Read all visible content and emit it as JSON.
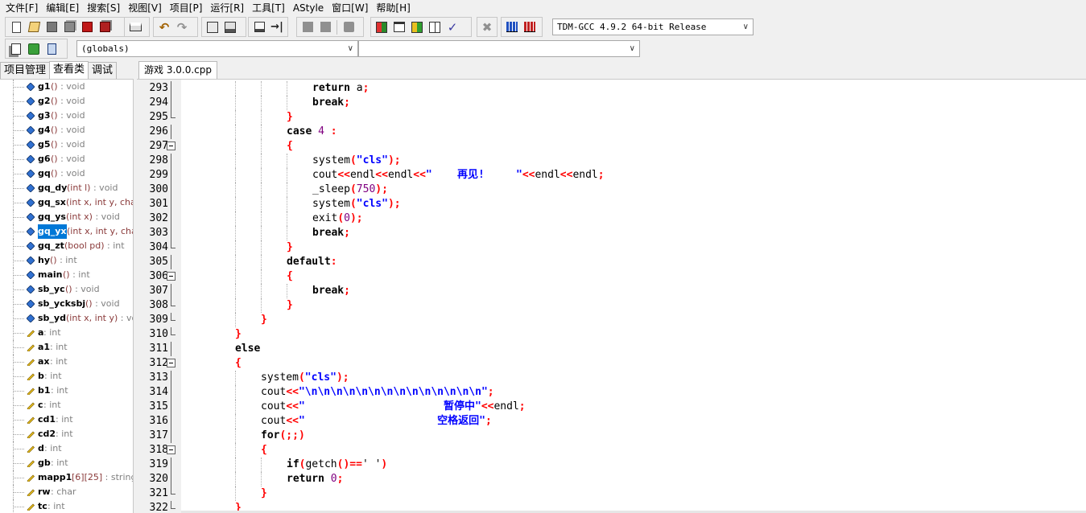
{
  "menu": [
    "文件[F]",
    "编辑[E]",
    "搜索[S]",
    "视图[V]",
    "项目[P]",
    "运行[R]",
    "工具[T]",
    "AStyle",
    "窗口[W]",
    "帮助[H]"
  ],
  "compiler": "TDM-GCC 4.9.2 64-bit Release",
  "scope_combo": "(globals)",
  "member_combo": "",
  "left_tabs": [
    "项目管理",
    "查看类",
    "调试"
  ],
  "active_left_tab": 1,
  "file_tab": "游戏 3.0.0.cpp",
  "colors": {
    "keyword": "#000000",
    "symbol": "#ff0000",
    "string": "#0000ff",
    "number": "#800080",
    "selection": "#0078d7"
  },
  "class_tree": [
    {
      "kind": "function",
      "name": "g1",
      "sig": "()",
      "type": ": void"
    },
    {
      "kind": "function",
      "name": "g2",
      "sig": "()",
      "type": ": void"
    },
    {
      "kind": "function",
      "name": "g3",
      "sig": "()",
      "type": ": void"
    },
    {
      "kind": "function",
      "name": "g4",
      "sig": "()",
      "type": ": void"
    },
    {
      "kind": "function",
      "name": "g5",
      "sig": "()",
      "type": ": void"
    },
    {
      "kind": "function",
      "name": "g6",
      "sig": "()",
      "type": ": void"
    },
    {
      "kind": "function",
      "name": "gq",
      "sig": "()",
      "type": ": void"
    },
    {
      "kind": "function",
      "name": "gq_dy",
      "sig": "(int l)",
      "type": ": void"
    },
    {
      "kind": "function",
      "name": "gq_sx",
      "sig": "(int x, int y, char",
      "type": ""
    },
    {
      "kind": "function",
      "name": "gq_ys",
      "sig": "(int x)",
      "type": ": void"
    },
    {
      "kind": "function",
      "name": "gq_yx",
      "sig": "(int x, int y, char",
      "type": "",
      "selected": true
    },
    {
      "kind": "function",
      "name": "gq_zt",
      "sig": "(bool pd)",
      "type": ": int"
    },
    {
      "kind": "function",
      "name": "hy",
      "sig": "()",
      "type": ": int"
    },
    {
      "kind": "function",
      "name": "main",
      "sig": "()",
      "type": ": int"
    },
    {
      "kind": "function",
      "name": "sb_yc",
      "sig": "()",
      "type": ": void"
    },
    {
      "kind": "function",
      "name": "sb_ycksbj",
      "sig": "()",
      "type": ": void"
    },
    {
      "kind": "function",
      "name": "sb_yd",
      "sig": "(int x, int y)",
      "type": ": voic"
    },
    {
      "kind": "variable",
      "name": "a",
      "sig": "",
      "type": ": int"
    },
    {
      "kind": "variable",
      "name": "a1",
      "sig": "",
      "type": ": int"
    },
    {
      "kind": "variable",
      "name": "ax",
      "sig": "",
      "type": ": int"
    },
    {
      "kind": "variable",
      "name": "b",
      "sig": "",
      "type": ": int"
    },
    {
      "kind": "variable",
      "name": "b1",
      "sig": "",
      "type": ": int"
    },
    {
      "kind": "variable",
      "name": "c",
      "sig": "",
      "type": ": int"
    },
    {
      "kind": "variable",
      "name": "cd1",
      "sig": "",
      "type": ": int"
    },
    {
      "kind": "variable",
      "name": "cd2",
      "sig": "",
      "type": ": int"
    },
    {
      "kind": "variable",
      "name": "d",
      "sig": "",
      "type": ": int"
    },
    {
      "kind": "variable",
      "name": "gb",
      "sig": "",
      "type": ": int"
    },
    {
      "kind": "variable",
      "name": "mapp1",
      "sig": "[6][25]",
      "type": ": string"
    },
    {
      "kind": "variable",
      "name": "rw",
      "sig": "",
      "type": ": char"
    },
    {
      "kind": "variable",
      "name": "tc",
      "sig": "",
      "type": ": int"
    }
  ],
  "code_lines": [
    {
      "n": "293",
      "indent": 4,
      "fold": "",
      "tokens": [
        [
          "kw",
          "return"
        ],
        [
          "id",
          " a"
        ],
        [
          "sym",
          ";"
        ]
      ]
    },
    {
      "n": "294",
      "indent": 4,
      "fold": "",
      "tokens": [
        [
          "kw",
          "break"
        ],
        [
          "sym",
          ";"
        ]
      ]
    },
    {
      "n": "295",
      "indent": 3,
      "fold": "end",
      "tokens": [
        [
          "sym",
          "}"
        ]
      ]
    },
    {
      "n": "296",
      "indent": 3,
      "fold": "",
      "tokens": [
        [
          "kw",
          "case"
        ],
        [
          "id",
          " "
        ],
        [
          "num",
          "4"
        ],
        [
          "id",
          " "
        ],
        [
          "sym",
          ":"
        ]
      ]
    },
    {
      "n": "297",
      "indent": 3,
      "fold": "start",
      "tokens": [
        [
          "sym",
          "{"
        ]
      ]
    },
    {
      "n": "298",
      "indent": 4,
      "fold": "",
      "tokens": [
        [
          "id",
          "system"
        ],
        [
          "sym",
          "("
        ],
        [
          "str",
          "\"cls\""
        ],
        [
          "sym",
          ");"
        ]
      ]
    },
    {
      "n": "299",
      "indent": 4,
      "fold": "",
      "tokens": [
        [
          "id",
          "cout"
        ],
        [
          "sym",
          "<<"
        ],
        [
          "id",
          "endl"
        ],
        [
          "sym",
          "<<"
        ],
        [
          "id",
          "endl"
        ],
        [
          "sym",
          "<<"
        ],
        [
          "str",
          "\"    再见!     \""
        ],
        [
          "sym",
          "<<"
        ],
        [
          "id",
          "endl"
        ],
        [
          "sym",
          "<<"
        ],
        [
          "id",
          "endl"
        ],
        [
          "sym",
          ";"
        ]
      ]
    },
    {
      "n": "300",
      "indent": 4,
      "fold": "",
      "tokens": [
        [
          "id",
          "_sleep"
        ],
        [
          "sym",
          "("
        ],
        [
          "num",
          "750"
        ],
        [
          "sym",
          ");"
        ]
      ]
    },
    {
      "n": "301",
      "indent": 4,
      "fold": "",
      "tokens": [
        [
          "id",
          "system"
        ],
        [
          "sym",
          "("
        ],
        [
          "str",
          "\"cls\""
        ],
        [
          "sym",
          ");"
        ]
      ]
    },
    {
      "n": "302",
      "indent": 4,
      "fold": "",
      "tokens": [
        [
          "id",
          "exit"
        ],
        [
          "sym",
          "("
        ],
        [
          "num",
          "0"
        ],
        [
          "sym",
          ");"
        ]
      ]
    },
    {
      "n": "303",
      "indent": 4,
      "fold": "",
      "tokens": [
        [
          "kw",
          "break"
        ],
        [
          "sym",
          ";"
        ]
      ]
    },
    {
      "n": "304",
      "indent": 3,
      "fold": "end",
      "tokens": [
        [
          "sym",
          "}"
        ]
      ]
    },
    {
      "n": "305",
      "indent": 3,
      "fold": "",
      "tokens": [
        [
          "kw",
          "default"
        ],
        [
          "sym",
          ":"
        ]
      ]
    },
    {
      "n": "306",
      "indent": 3,
      "fold": "start",
      "tokens": [
        [
          "sym",
          "{"
        ]
      ]
    },
    {
      "n": "307",
      "indent": 4,
      "fold": "",
      "tokens": [
        [
          "kw",
          "break"
        ],
        [
          "sym",
          ";"
        ]
      ]
    },
    {
      "n": "308",
      "indent": 3,
      "fold": "end",
      "tokens": [
        [
          "sym",
          "}"
        ]
      ]
    },
    {
      "n": "309",
      "indent": 2,
      "fold": "end",
      "tokens": [
        [
          "sym",
          "}"
        ]
      ]
    },
    {
      "n": "310",
      "indent": 1,
      "fold": "end",
      "tokens": [
        [
          "sym",
          "}"
        ]
      ]
    },
    {
      "n": "311",
      "indent": 1,
      "fold": "",
      "tokens": [
        [
          "kw",
          "else"
        ]
      ]
    },
    {
      "n": "312",
      "indent": 1,
      "fold": "start",
      "tokens": [
        [
          "sym",
          "{"
        ]
      ]
    },
    {
      "n": "313",
      "indent": 2,
      "fold": "",
      "tokens": [
        [
          "id",
          "system"
        ],
        [
          "sym",
          "("
        ],
        [
          "str",
          "\"cls\""
        ],
        [
          "sym",
          ");"
        ]
      ]
    },
    {
      "n": "314",
      "indent": 2,
      "fold": "",
      "tokens": [
        [
          "id",
          "cout"
        ],
        [
          "sym",
          "<<"
        ],
        [
          "str",
          "\"\\n\\n\\n\\n\\n\\n\\n\\n\\n\\n\\n\\n\\n\\n\""
        ],
        [
          "sym",
          ";"
        ]
      ]
    },
    {
      "n": "315",
      "indent": 2,
      "fold": "",
      "tokens": [
        [
          "id",
          "cout"
        ],
        [
          "sym",
          "<<"
        ],
        [
          "str",
          "\"                      暂停中\""
        ],
        [
          "sym",
          "<<"
        ],
        [
          "id",
          "endl"
        ],
        [
          "sym",
          ";"
        ]
      ]
    },
    {
      "n": "316",
      "indent": 2,
      "fold": "",
      "tokens": [
        [
          "id",
          "cout"
        ],
        [
          "sym",
          "<<"
        ],
        [
          "str",
          "\"                     空格返回\""
        ],
        [
          "sym",
          ";"
        ]
      ]
    },
    {
      "n": "317",
      "indent": 2,
      "fold": "",
      "tokens": [
        [
          "kw",
          "for"
        ],
        [
          "sym",
          "(;;)"
        ]
      ]
    },
    {
      "n": "318",
      "indent": 2,
      "fold": "start",
      "tokens": [
        [
          "sym",
          "{"
        ]
      ]
    },
    {
      "n": "319",
      "indent": 3,
      "fold": "",
      "tokens": [
        [
          "kw",
          "if"
        ],
        [
          "sym",
          "("
        ],
        [
          "id",
          "getch"
        ],
        [
          "sym",
          "()=="
        ],
        [
          "id",
          "' '"
        ],
        [
          "sym",
          ")"
        ]
      ]
    },
    {
      "n": "320",
      "indent": 3,
      "fold": "",
      "tokens": [
        [
          "kw",
          "return"
        ],
        [
          "id",
          " "
        ],
        [
          "num",
          "0"
        ],
        [
          "sym",
          ";"
        ]
      ]
    },
    {
      "n": "321",
      "indent": 2,
      "fold": "end",
      "tokens": [
        [
          "sym",
          "}"
        ]
      ]
    },
    {
      "n": "322",
      "indent": 1,
      "fold": "end",
      "tokens": [
        [
          "sym",
          "}"
        ]
      ]
    }
  ]
}
